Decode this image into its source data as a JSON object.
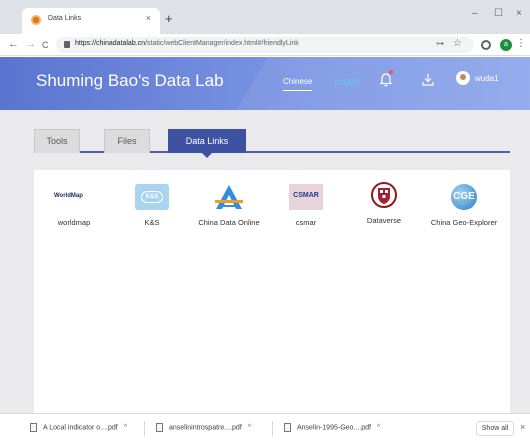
{
  "browser": {
    "tab_title": "Data Links",
    "tab_close": "×",
    "new_tab": "+",
    "window_min": "–",
    "window_max": "☐",
    "window_close": "×",
    "back": "←",
    "forward": "→",
    "reload": "C",
    "url_host": "https://chinadatalab.cn",
    "url_path": "/static/webClientManager/index.html#/friendlyLink",
    "profile_initial": "a"
  },
  "header": {
    "brand": "Shuming Bao's Data Lab",
    "lang_chinese": "Chinese",
    "lang_english": "English",
    "username": "wuda1"
  },
  "tabs": [
    {
      "label": "Tools",
      "active": false
    },
    {
      "label": "Files",
      "active": false
    },
    {
      "label": "Data Links",
      "active": true
    }
  ],
  "links": [
    {
      "label": "worldmap",
      "logo_text": "WorldMap"
    },
    {
      "label": "K&S",
      "logo_text": "K&S"
    },
    {
      "label": "China Data Online"
    },
    {
      "label": "csmar",
      "logo_text": "CSMAR"
    },
    {
      "label": "Dataverse"
    },
    {
      "label": "China Geo-Explorer",
      "logo_text": "CGE"
    }
  ],
  "downloads": {
    "items": [
      "A Local indicator o....pdf",
      "anselinintrospatre....pdf",
      "Anselin-1995-Geo....pdf"
    ],
    "caret": "^",
    "show_all": "Show all",
    "close": "×"
  },
  "colors": {
    "header_start": "#5b74cf",
    "header_end": "#8ca6ec",
    "active_tab": "#3f51a3",
    "english_link": "#5ec8f0"
  }
}
